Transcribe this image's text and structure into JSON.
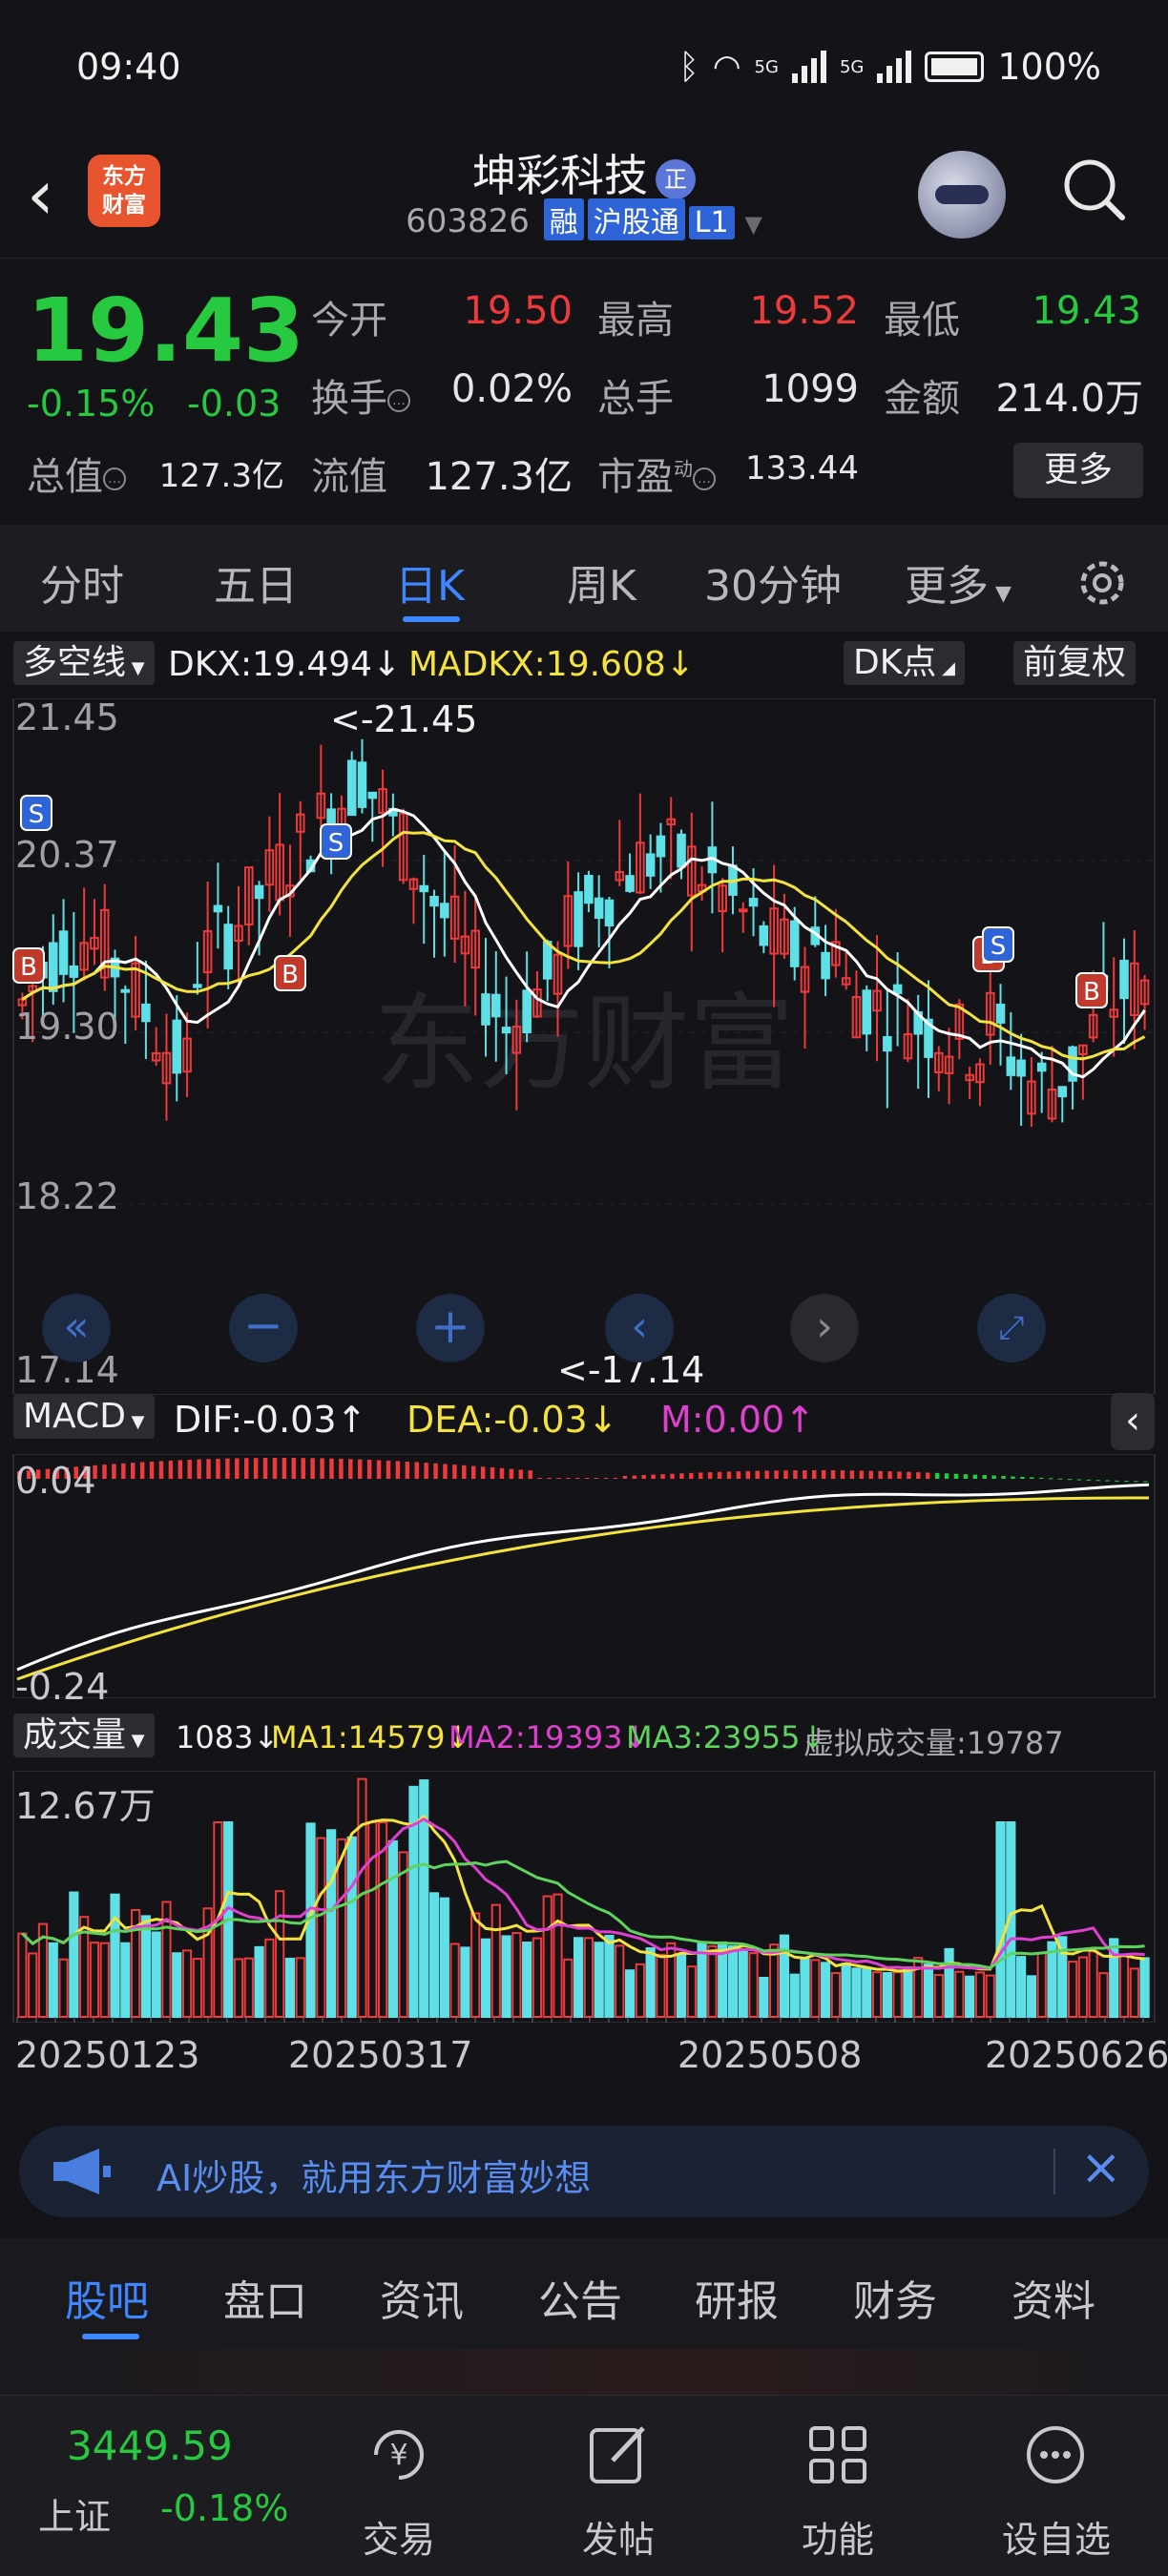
{
  "status_bar": {
    "time": "09:40",
    "net1": "5G",
    "net2": "5G",
    "battery": "100%"
  },
  "header": {
    "title": "坤彩科技",
    "badge": "正",
    "code": "603826",
    "tags": [
      "融",
      "沪股通",
      "L1"
    ],
    "logo_line1": "东方",
    "logo_line2": "财富"
  },
  "quote": {
    "price": "19.43",
    "change_pct": "-0.15%",
    "change": "-0.03",
    "open_label": "今开",
    "open": "19.50",
    "high_label": "最高",
    "high": "19.52",
    "low_label": "最低",
    "low": "19.43",
    "turnover_label": "换手",
    "turnover": "0.02%",
    "volume_label": "总手",
    "volume": "1099",
    "amount_label": "金额",
    "amount": "214.0万",
    "mcap_label": "总值",
    "mcap": "127.3亿",
    "float_label": "流值",
    "float": "127.3亿",
    "pe_label": "市盈",
    "pe_sup": "动",
    "pe": "133.44",
    "more": "更多"
  },
  "tabs": [
    "分时",
    "五日",
    "日K",
    "周K",
    "30分钟",
    "更多"
  ],
  "kline": {
    "indicator_select": "多空线",
    "dkx": "DKX:19.494↓",
    "madkx": "MADKX:19.608↓",
    "dk_select": "DK点",
    "fq_select": "前复权",
    "y_ticks": [
      "21.45",
      "20.37",
      "19.30",
      "18.22",
      "17.14"
    ],
    "hi_marker": "<-21.45",
    "lo_marker": "<-17.14",
    "watermark": "东方财富"
  },
  "macd": {
    "select": "MACD",
    "dif": "DIF:-0.03↑",
    "dea": "DEA:-0.03↓",
    "m": "M:0.00↑",
    "y_top": "0.04",
    "y_bottom": "-0.24"
  },
  "volume": {
    "select": "成交量",
    "v": "1083↓",
    "ma1": "MA1:14579↓",
    "ma2": "MA2:19393↓",
    "ma3": "MA3:23955↓",
    "virtual": "虚拟成交量:19787",
    "y_top": "12.67万",
    "dates": [
      "20250123",
      "20250317",
      "20250508",
      "20250626"
    ]
  },
  "ad": {
    "text": "AI炒股，就用东方财富妙想"
  },
  "sub_tabs": [
    "股吧",
    "盘口",
    "资讯",
    "公告",
    "研报",
    "财务",
    "资料"
  ],
  "bottom_nav": {
    "index_value": "3449.59",
    "index_name": "上证",
    "index_change": "-0.18%",
    "items": [
      "交易",
      "发帖",
      "功能",
      "设自选"
    ]
  },
  "colors": {
    "up": "#ee3a3a",
    "down": "#26c93f",
    "candle_down": "#5ee0e6",
    "accent": "#3f87ff"
  }
}
